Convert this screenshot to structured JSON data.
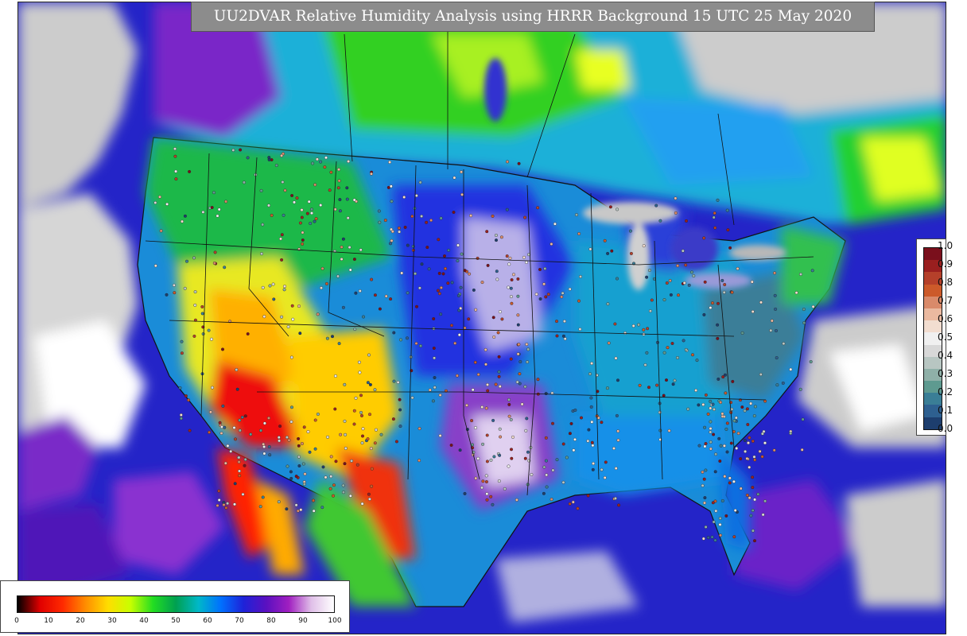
{
  "title": "UU2DVAR Relative Humidity Analysis using HRRR Background 15 UTC 25 May 2020",
  "obs_legend": {
    "labels": [
      "1.0",
      "0.9",
      "0.8",
      "0.7",
      "0.6",
      "0.5",
      "0.4",
      "0.3",
      "0.2",
      "0.1",
      "0.0"
    ],
    "colors": [
      "#7a0f1c",
      "#9a1f1f",
      "#b5402a",
      "#cc5a2a",
      "#d98a6a",
      "#eab9a0",
      "#f2ddd0",
      "#f0f0f0",
      "#d8d8d8",
      "#b8c6c2",
      "#8fb0a8",
      "#5e9a90",
      "#3a7e96",
      "#2e6090",
      "#1d3e6e"
    ]
  },
  "rh_colorbar": {
    "ticks": [
      "0",
      "10",
      "20",
      "30",
      "40",
      "50",
      "60",
      "70",
      "80",
      "90",
      "100"
    ],
    "stops": [
      "#000000",
      "#e00000",
      "#ff2a00",
      "#ff8c00",
      "#ffdd00",
      "#c8ff00",
      "#22dd22",
      "#00a050",
      "#00b8c8",
      "#0070ff",
      "#1e22d8",
      "#5a10c0",
      "#a01fc0",
      "#e0c0e8",
      "#ffffff"
    ]
  },
  "map_colors": {
    "ocean": "#2424c8",
    "ocean_dark": "#1a1aa8",
    "land_outside": "#cccccc",
    "border": "#111111"
  }
}
